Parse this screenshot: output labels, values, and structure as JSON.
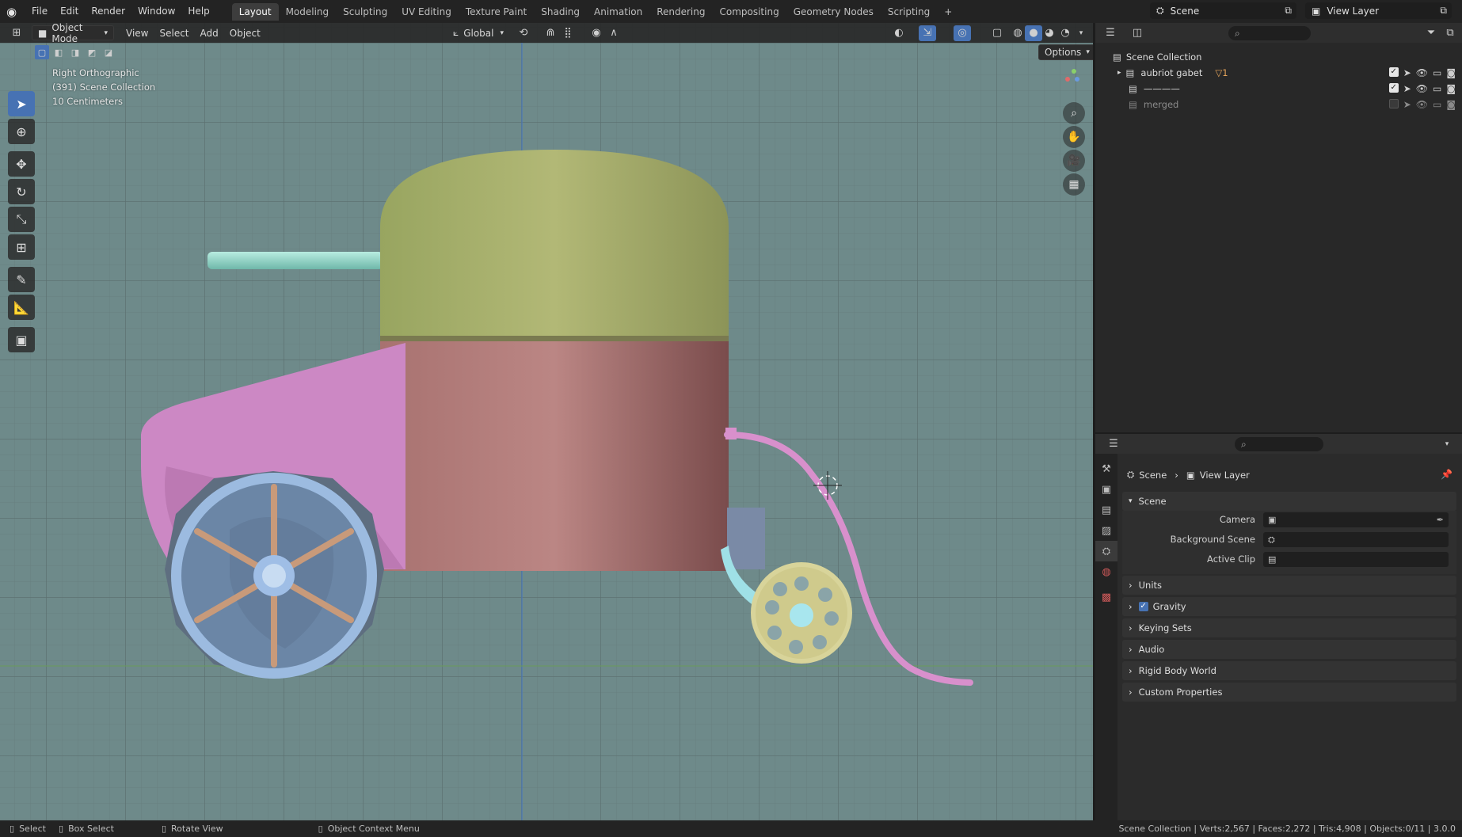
{
  "menu": {
    "items": [
      "File",
      "Edit",
      "Render",
      "Window",
      "Help"
    ]
  },
  "workspaces": {
    "tabs": [
      "Layout",
      "Modeling",
      "Sculpting",
      "UV Editing",
      "Texture Paint",
      "Shading",
      "Animation",
      "Rendering",
      "Compositing",
      "Geometry Nodes",
      "Scripting"
    ],
    "active": "Layout",
    "add_label": "+"
  },
  "top_right": {
    "scene": "Scene",
    "view_layer": "View Layer"
  },
  "viewport_header": {
    "mode": "Object Mode",
    "menus": [
      "View",
      "Select",
      "Add",
      "Object"
    ],
    "transform_orientation": "Global",
    "options_label": "Options"
  },
  "viewport_overlay": {
    "view_name": "Right Orthographic",
    "collection_info": "(391) Scene Collection",
    "grid_scale": "10 Centimeters"
  },
  "outliner": {
    "root": "Scene Collection",
    "rows": [
      {
        "name": "aubriot gabet",
        "enabled": true,
        "badge": "▽1"
      },
      {
        "name": "————",
        "enabled": true,
        "badge": ""
      },
      {
        "name": "merged",
        "enabled": false,
        "badge": ""
      }
    ]
  },
  "properties": {
    "breadcrumb": [
      "Scene",
      "View Layer"
    ],
    "scene_panel": "Scene",
    "fields": [
      {
        "label": "Camera",
        "value": ""
      },
      {
        "label": "Background Scene",
        "value": ""
      },
      {
        "label": "Active Clip",
        "value": ""
      }
    ],
    "panels": [
      {
        "label": "Units",
        "checkbox": false
      },
      {
        "label": "Gravity",
        "checkbox": true
      },
      {
        "label": "Keying Sets",
        "checkbox": false
      },
      {
        "label": "Audio",
        "checkbox": false
      },
      {
        "label": "Rigid Body World",
        "checkbox": false
      },
      {
        "label": "Custom Properties",
        "checkbox": false
      }
    ]
  },
  "statusbar": {
    "select": "Select",
    "box_select": "Box Select",
    "rotate_view": "Rotate View",
    "context_menu": "Object Context Menu",
    "stats": "Scene Collection | Verts:2,567 | Faces:2,272 | Tris:4,908 | Objects:0/11 | 3.0.0"
  },
  "colors": {
    "viewport_bg": "#6e8a8a",
    "tank_top": "#a8b06c",
    "tank_body": "#b27a78",
    "fender": "#cc88c4",
    "wheel": "#8fb0d8",
    "small_wheel": "#d8d49a",
    "pipe": "#d890cc",
    "accent": "#4772b3"
  }
}
